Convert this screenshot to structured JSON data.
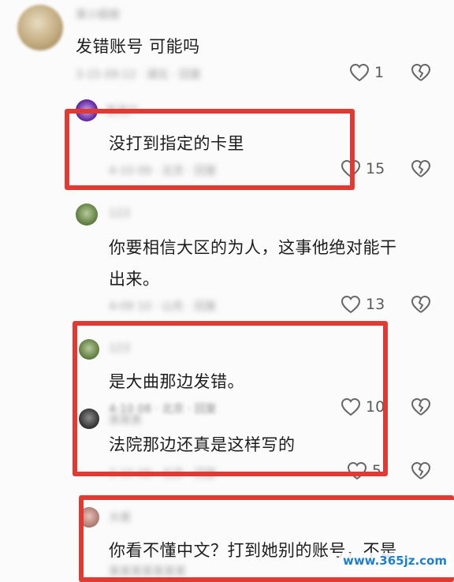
{
  "comments": [
    {
      "text": "发错账号 可能吗",
      "likes": "1"
    },
    {
      "text": "没打到指定的卡里",
      "likes": "15"
    },
    {
      "text_line1": "你要相信大区的为人，这事他绝对能干",
      "text_line2": "出来。",
      "likes": "13"
    },
    {
      "text": "是大曲那边发错。",
      "likes": "10"
    },
    {
      "text": "法院那边还真是这样写的",
      "likes": "5"
    },
    {
      "text": "你看不懂中文？打到她别的账号，不是"
    }
  ],
  "watermark": "www.365jz.com",
  "colors": {
    "highlight": "#e03a33",
    "watermark": "#1f7fcf"
  },
  "icons": [
    "heart-icon",
    "broken-heart-icon"
  ]
}
